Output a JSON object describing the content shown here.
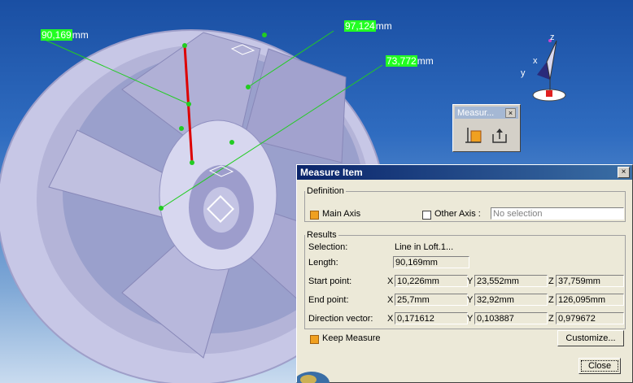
{
  "viewport": {
    "dimensions": [
      {
        "text": "90,169",
        "unit": "mm"
      },
      {
        "text": "97,124",
        "unit": "mm"
      },
      {
        "text": "73,772",
        "unit": "mm"
      }
    ],
    "axis": {
      "x": "x",
      "y": "y",
      "z": "z"
    }
  },
  "toolbar": {
    "title": "Measur...",
    "close": "×"
  },
  "dialog": {
    "title": "Measure Item",
    "close": "×",
    "definition": {
      "legend": "Definition",
      "main_axis": "Main Axis",
      "main_axis_checked": true,
      "other_axis": "Other Axis :",
      "other_axis_checked": false,
      "other_axis_value": "No selection"
    },
    "results": {
      "legend": "Results",
      "selection_label": "Selection:",
      "selection_value": "Line in Loft.1...",
      "length_label": "Length:",
      "length_value": "90,169mm",
      "start_label": "Start point:",
      "start": {
        "x": "10,226mm",
        "y": "23,552mm",
        "z": "37,759mm"
      },
      "end_label": "End point:",
      "end": {
        "x": "25,7mm",
        "y": "32,92mm",
        "z": "126,095mm"
      },
      "dir_label": "Direction vector:",
      "dir": {
        "x": "0,171612",
        "y": "0,103887",
        "z": "0,979672"
      },
      "coord_x": "X",
      "coord_y": "Y",
      "coord_z": "Z"
    },
    "keep_measure": "Keep Measure",
    "keep_measure_checked": true,
    "customize": "Customize...",
    "close_button": "Close"
  }
}
